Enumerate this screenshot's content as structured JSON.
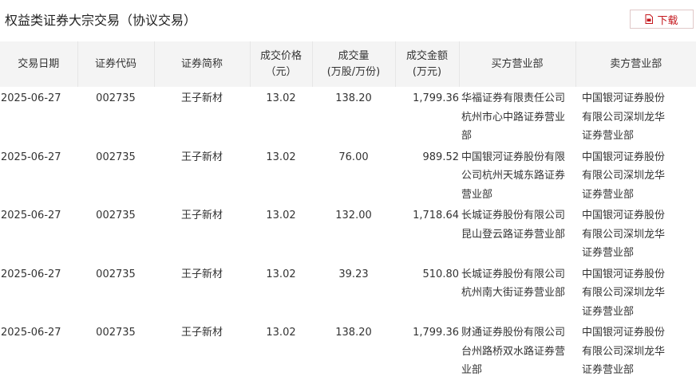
{
  "page": {
    "title": "权益类证券大宗交易（协议交易）",
    "download_label": "下载"
  },
  "table": {
    "headers": {
      "date": "交易日期",
      "code": "证券代码",
      "name": "证券简称",
      "price_l1": "成交价格",
      "price_l2": "（元）",
      "vol_l1": "成交量",
      "vol_l2": "(万股/万份)",
      "amt_l1": "成交金额",
      "amt_l2": "(万元)",
      "buyer": "买方营业部",
      "seller": "卖方营业部"
    },
    "rows": [
      {
        "date": "2025-06-27",
        "code": "002735",
        "name": "王子新材",
        "price": "13.02",
        "volume": "138.20",
        "amount": "1,799.36",
        "buyer": "华福证券有限责任公司杭州市心中路证券营业部",
        "seller": "中国银河证券股份有限公司深圳龙华证券营业部"
      },
      {
        "date": "2025-06-27",
        "code": "002735",
        "name": "王子新材",
        "price": "13.02",
        "volume": "76.00",
        "amount": "989.52",
        "buyer": "中国银河证券股份有限公司杭州天城东路证券营业部",
        "seller": "中国银河证券股份有限公司深圳龙华证券营业部"
      },
      {
        "date": "2025-06-27",
        "code": "002735",
        "name": "王子新材",
        "price": "13.02",
        "volume": "132.00",
        "amount": "1,718.64",
        "buyer": "长城证券股份有限公司昆山登云路证券营业部",
        "seller": "中国银河证券股份有限公司深圳龙华证券营业部"
      },
      {
        "date": "2025-06-27",
        "code": "002735",
        "name": "王子新材",
        "price": "13.02",
        "volume": "39.23",
        "amount": "510.80",
        "buyer": "长城证券股份有限公司杭州南大街证券营业部",
        "seller": "中国银河证券股份有限公司深圳龙华证券营业部"
      },
      {
        "date": "2025-06-27",
        "code": "002735",
        "name": "王子新材",
        "price": "13.02",
        "volume": "138.20",
        "amount": "1,799.36",
        "buyer": "财通证券股份有限公司台州路桥双水路证券营业部",
        "seller": "中国银河证券股份有限公司深圳龙华证券营业部"
      }
    ]
  },
  "colors": {
    "accent": "#c4161c",
    "header_bg": "#f4f4f4"
  },
  "icons": {
    "download": "pdf-download-icon"
  }
}
